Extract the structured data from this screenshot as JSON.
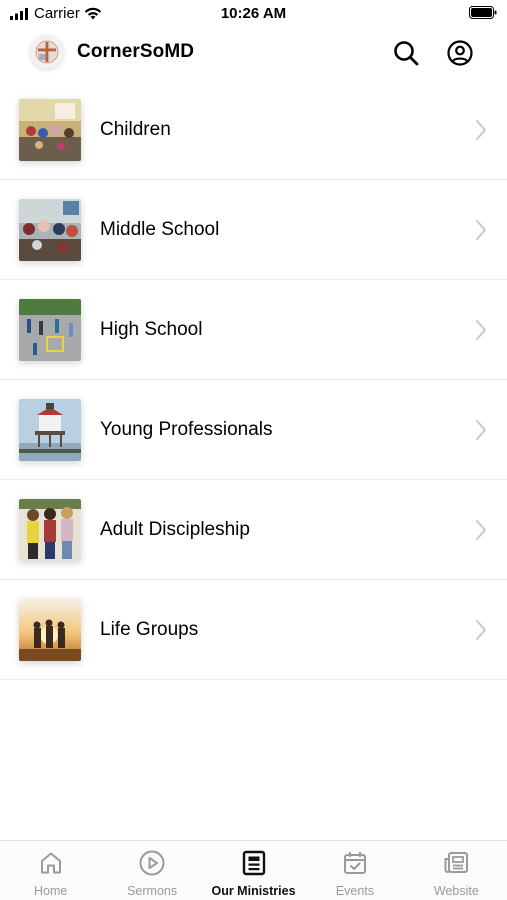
{
  "status_bar": {
    "carrier": "Carrier",
    "time": "10:26 AM"
  },
  "header": {
    "title": "CornerSoMD",
    "logo_icon": "church-cross-logo"
  },
  "ministries": [
    {
      "label": "Children",
      "image": "children-classroom-photo"
    },
    {
      "label": "Middle School",
      "image": "middle-school-group-photo"
    },
    {
      "label": "High School",
      "image": "high-school-outdoor-photo"
    },
    {
      "label": "Young Professionals",
      "image": "lighthouse-photo"
    },
    {
      "label": "Adult Discipleship",
      "image": "adult-group-photo"
    },
    {
      "label": "Life Groups",
      "image": "sunset-silhouettes-photo"
    }
  ],
  "tabs": [
    {
      "label": "Home",
      "icon": "home-icon",
      "active": false
    },
    {
      "label": "Sermons",
      "icon": "play-circle-icon",
      "active": false
    },
    {
      "label": "Our Ministries",
      "icon": "ministries-icon",
      "active": true
    },
    {
      "label": "Events",
      "icon": "calendar-check-icon",
      "active": false
    },
    {
      "label": "Website",
      "icon": "newspaper-icon",
      "active": false
    }
  ],
  "colors": {
    "active_tab": "#111111",
    "inactive_tab": "#9a9a9a",
    "chevron": "#c7c7cc",
    "divider": "#ececec"
  }
}
